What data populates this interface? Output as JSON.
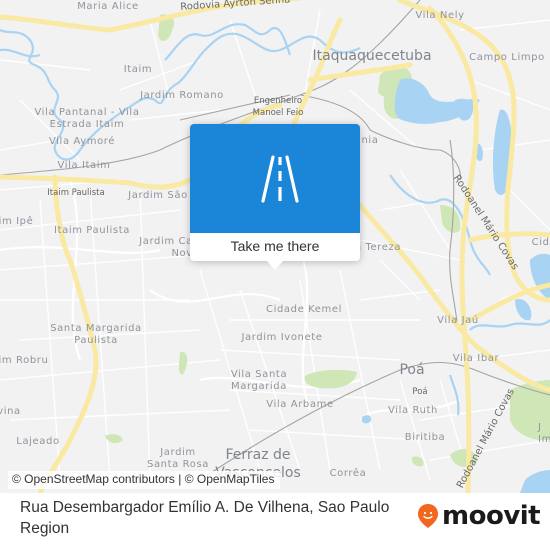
{
  "map": {
    "colors": {
      "background": "#f2f2f3",
      "major_road": "#f9e9a2",
      "water": "#a9d3f2",
      "park": "#cfe6b6",
      "rail": "#a4a4a4",
      "minor_road": "#ffffff"
    },
    "places": [
      {
        "name": "Maria Alice",
        "kind": "district"
      },
      {
        "name": "Vila Nely",
        "kind": "district"
      },
      {
        "name": "Itaquaquecetuba",
        "kind": "city"
      },
      {
        "name": "Campo Limpo",
        "kind": "district"
      },
      {
        "name": "Itaim",
        "kind": "district"
      },
      {
        "name": "Jardim Romano",
        "kind": "district"
      },
      {
        "name": "Engenheiro\nManoel Feio",
        "kind": "station"
      },
      {
        "name": "Vila Pantanal - Vila\nEstrada Itaim",
        "kind": "district"
      },
      {
        "name": "Vila Aymoré",
        "kind": "district"
      },
      {
        "name": "Vila Itaim",
        "kind": "district"
      },
      {
        "name": "Itaim Paulista",
        "kind": "station"
      },
      {
        "name": "Jardim São",
        "kind": "district"
      },
      {
        "name": "im Ipê",
        "kind": "district"
      },
      {
        "name": "Itaim Paulista",
        "kind": "district"
      },
      {
        "name": "Jardim Ca\nNov",
        "kind": "district"
      },
      {
        "name": "nia",
        "kind": "district"
      },
      {
        "name": "a Tereza",
        "kind": "district"
      },
      {
        "name": "Cidade Kemel",
        "kind": "district"
      },
      {
        "name": "Cida",
        "kind": "district"
      },
      {
        "name": "Vila Jaú",
        "kind": "district"
      },
      {
        "name": "Jardim Ivonete",
        "kind": "district"
      },
      {
        "name": "Santa Margarida\nPaulista",
        "kind": "district"
      },
      {
        "name": "dim Robru",
        "kind": "district"
      },
      {
        "name": "Poá",
        "kind": "city"
      },
      {
        "name": "Vila Ibar",
        "kind": "district"
      },
      {
        "name": "Poá",
        "kind": "station"
      },
      {
        "name": "Vila Santa\nMargarida",
        "kind": "district"
      },
      {
        "name": "Vila Arbame",
        "kind": "district"
      },
      {
        "name": "Vila Ruth",
        "kind": "district"
      },
      {
        "name": "vina",
        "kind": "district"
      },
      {
        "name": "Lajeado",
        "kind": "district"
      },
      {
        "name": "Biritiba",
        "kind": "district"
      },
      {
        "name": "Jardim\nSanta Rosa",
        "kind": "district"
      },
      {
        "name": "Ferraz de\nVasconcelos",
        "kind": "city"
      },
      {
        "name": "Corrêa",
        "kind": "district"
      },
      {
        "name": "J\nIm",
        "kind": "district"
      }
    ],
    "roads": {
      "rodovia_ayrton_senna": "Rodovia Ayrton Senna",
      "rodoanel_north": "Rodoanel Mário Covas",
      "rodoanel_south": "Rodoanel Mário Covas"
    }
  },
  "popup": {
    "icon": "road-icon",
    "accent_color": "#1b85d8",
    "cta_label": "Take me there"
  },
  "attribution": "© OpenStreetMap contributors | © OpenMapTiles",
  "footer": {
    "address": "Rua Desembargador Emílio A. De Vilhena, Sao Paulo Region",
    "logo_text": "moovit",
    "logo_color": "#f2661e"
  }
}
